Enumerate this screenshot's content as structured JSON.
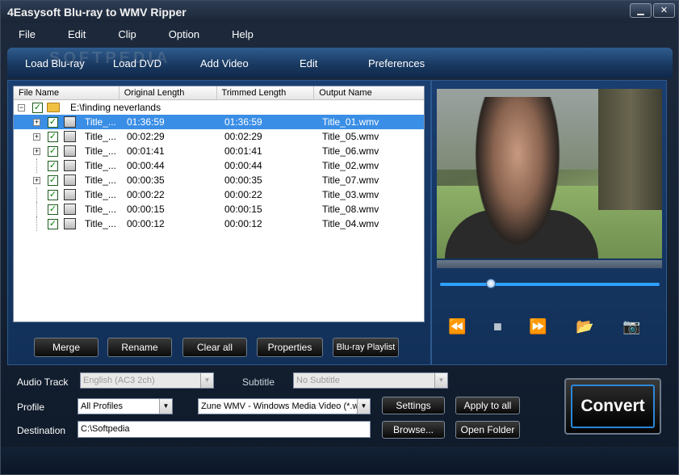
{
  "window": {
    "title": "4Easysoft Blu-ray to WMV Ripper",
    "controls": [
      "minimize",
      "close"
    ]
  },
  "menu": [
    "File",
    "Edit",
    "Clip",
    "Option",
    "Help"
  ],
  "toolbar": [
    "Load Blu-ray",
    "Load DVD",
    "Add Video",
    "Edit",
    "Preferences"
  ],
  "watermark": "SOFTPEDIA",
  "filelist": {
    "columns": [
      "File Name",
      "Original Length",
      "Trimmed Length",
      "Output Name"
    ],
    "root": "E:\\finding neverlands",
    "rows": [
      {
        "name": "Title_...",
        "original": "01:36:59",
        "trimmed": "01:36:59",
        "output": "Title_01.wmv",
        "selected": true,
        "expandable": true
      },
      {
        "name": "Title_...",
        "original": "00:02:29",
        "trimmed": "00:02:29",
        "output": "Title_05.wmv",
        "selected": false,
        "expandable": true
      },
      {
        "name": "Title_...",
        "original": "00:01:41",
        "trimmed": "00:01:41",
        "output": "Title_06.wmv",
        "selected": false,
        "expandable": true
      },
      {
        "name": "Title_...",
        "original": "00:00:44",
        "trimmed": "00:00:44",
        "output": "Title_02.wmv",
        "selected": false,
        "expandable": false
      },
      {
        "name": "Title_...",
        "original": "00:00:35",
        "trimmed": "00:00:35",
        "output": "Title_07.wmv",
        "selected": false,
        "expandable": true
      },
      {
        "name": "Title_...",
        "original": "00:00:22",
        "trimmed": "00:00:22",
        "output": "Title_03.wmv",
        "selected": false,
        "expandable": false
      },
      {
        "name": "Title_...",
        "original": "00:00:15",
        "trimmed": "00:00:15",
        "output": "Title_08.wmv",
        "selected": false,
        "expandable": false
      },
      {
        "name": "Title_...",
        "original": "00:00:12",
        "trimmed": "00:00:12",
        "output": "Title_04.wmv",
        "selected": false,
        "expandable": false
      }
    ]
  },
  "list_buttons": [
    "Merge",
    "Rename",
    "Clear all",
    "Properties",
    "Blu-ray Playlist"
  ],
  "preview": {
    "seek_fraction": 0.23,
    "controls": [
      "rewind-icon",
      "stop-icon",
      "fast-forward-icon",
      "open-folder-icon",
      "snapshot-icon"
    ]
  },
  "settings": {
    "audio_track_label": "Audio Track",
    "audio_track_value": "English (AC3 2ch)",
    "subtitle_label": "Subtitle",
    "subtitle_value": "No Subtitle",
    "profile_label": "Profile",
    "profile_category": "All Profiles",
    "profile_value": "Zune WMV - Windows Media Video (*.wmv)",
    "settings_button": "Settings",
    "apply_all_button": "Apply to all",
    "destination_label": "Destination",
    "destination_value": "C:\\Softpedia",
    "browse_button": "Browse...",
    "open_folder_button": "Open Folder",
    "convert_button": "Convert"
  }
}
